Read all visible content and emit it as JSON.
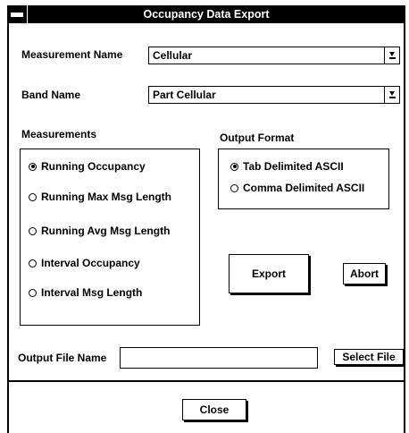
{
  "window": {
    "title": "Occupancy Data Export"
  },
  "measurement_name": {
    "label": "Measurement Name",
    "value": "Cellular"
  },
  "band_name": {
    "label": "Band Name",
    "value": "Part Cellular"
  },
  "measurements": {
    "label": "Measurements",
    "options": [
      {
        "label": "Running Occupancy",
        "selected": true
      },
      {
        "label": "Running Max Msg Length",
        "selected": false
      },
      {
        "label": "Running Avg Msg Length",
        "selected": false
      },
      {
        "label": "Interval Occupancy",
        "selected": false
      },
      {
        "label": "Interval Msg Length",
        "selected": false
      }
    ]
  },
  "output_format": {
    "label": "Output Format",
    "options": [
      {
        "label": "Tab Delimited ASCII",
        "selected": true
      },
      {
        "label": "Comma Delimited ASCII",
        "selected": false
      }
    ]
  },
  "buttons": {
    "export": "Export",
    "abort": "Abort",
    "select_file": "Select File",
    "close": "Close"
  },
  "output_file": {
    "label": "Output File Name",
    "value": ""
  }
}
